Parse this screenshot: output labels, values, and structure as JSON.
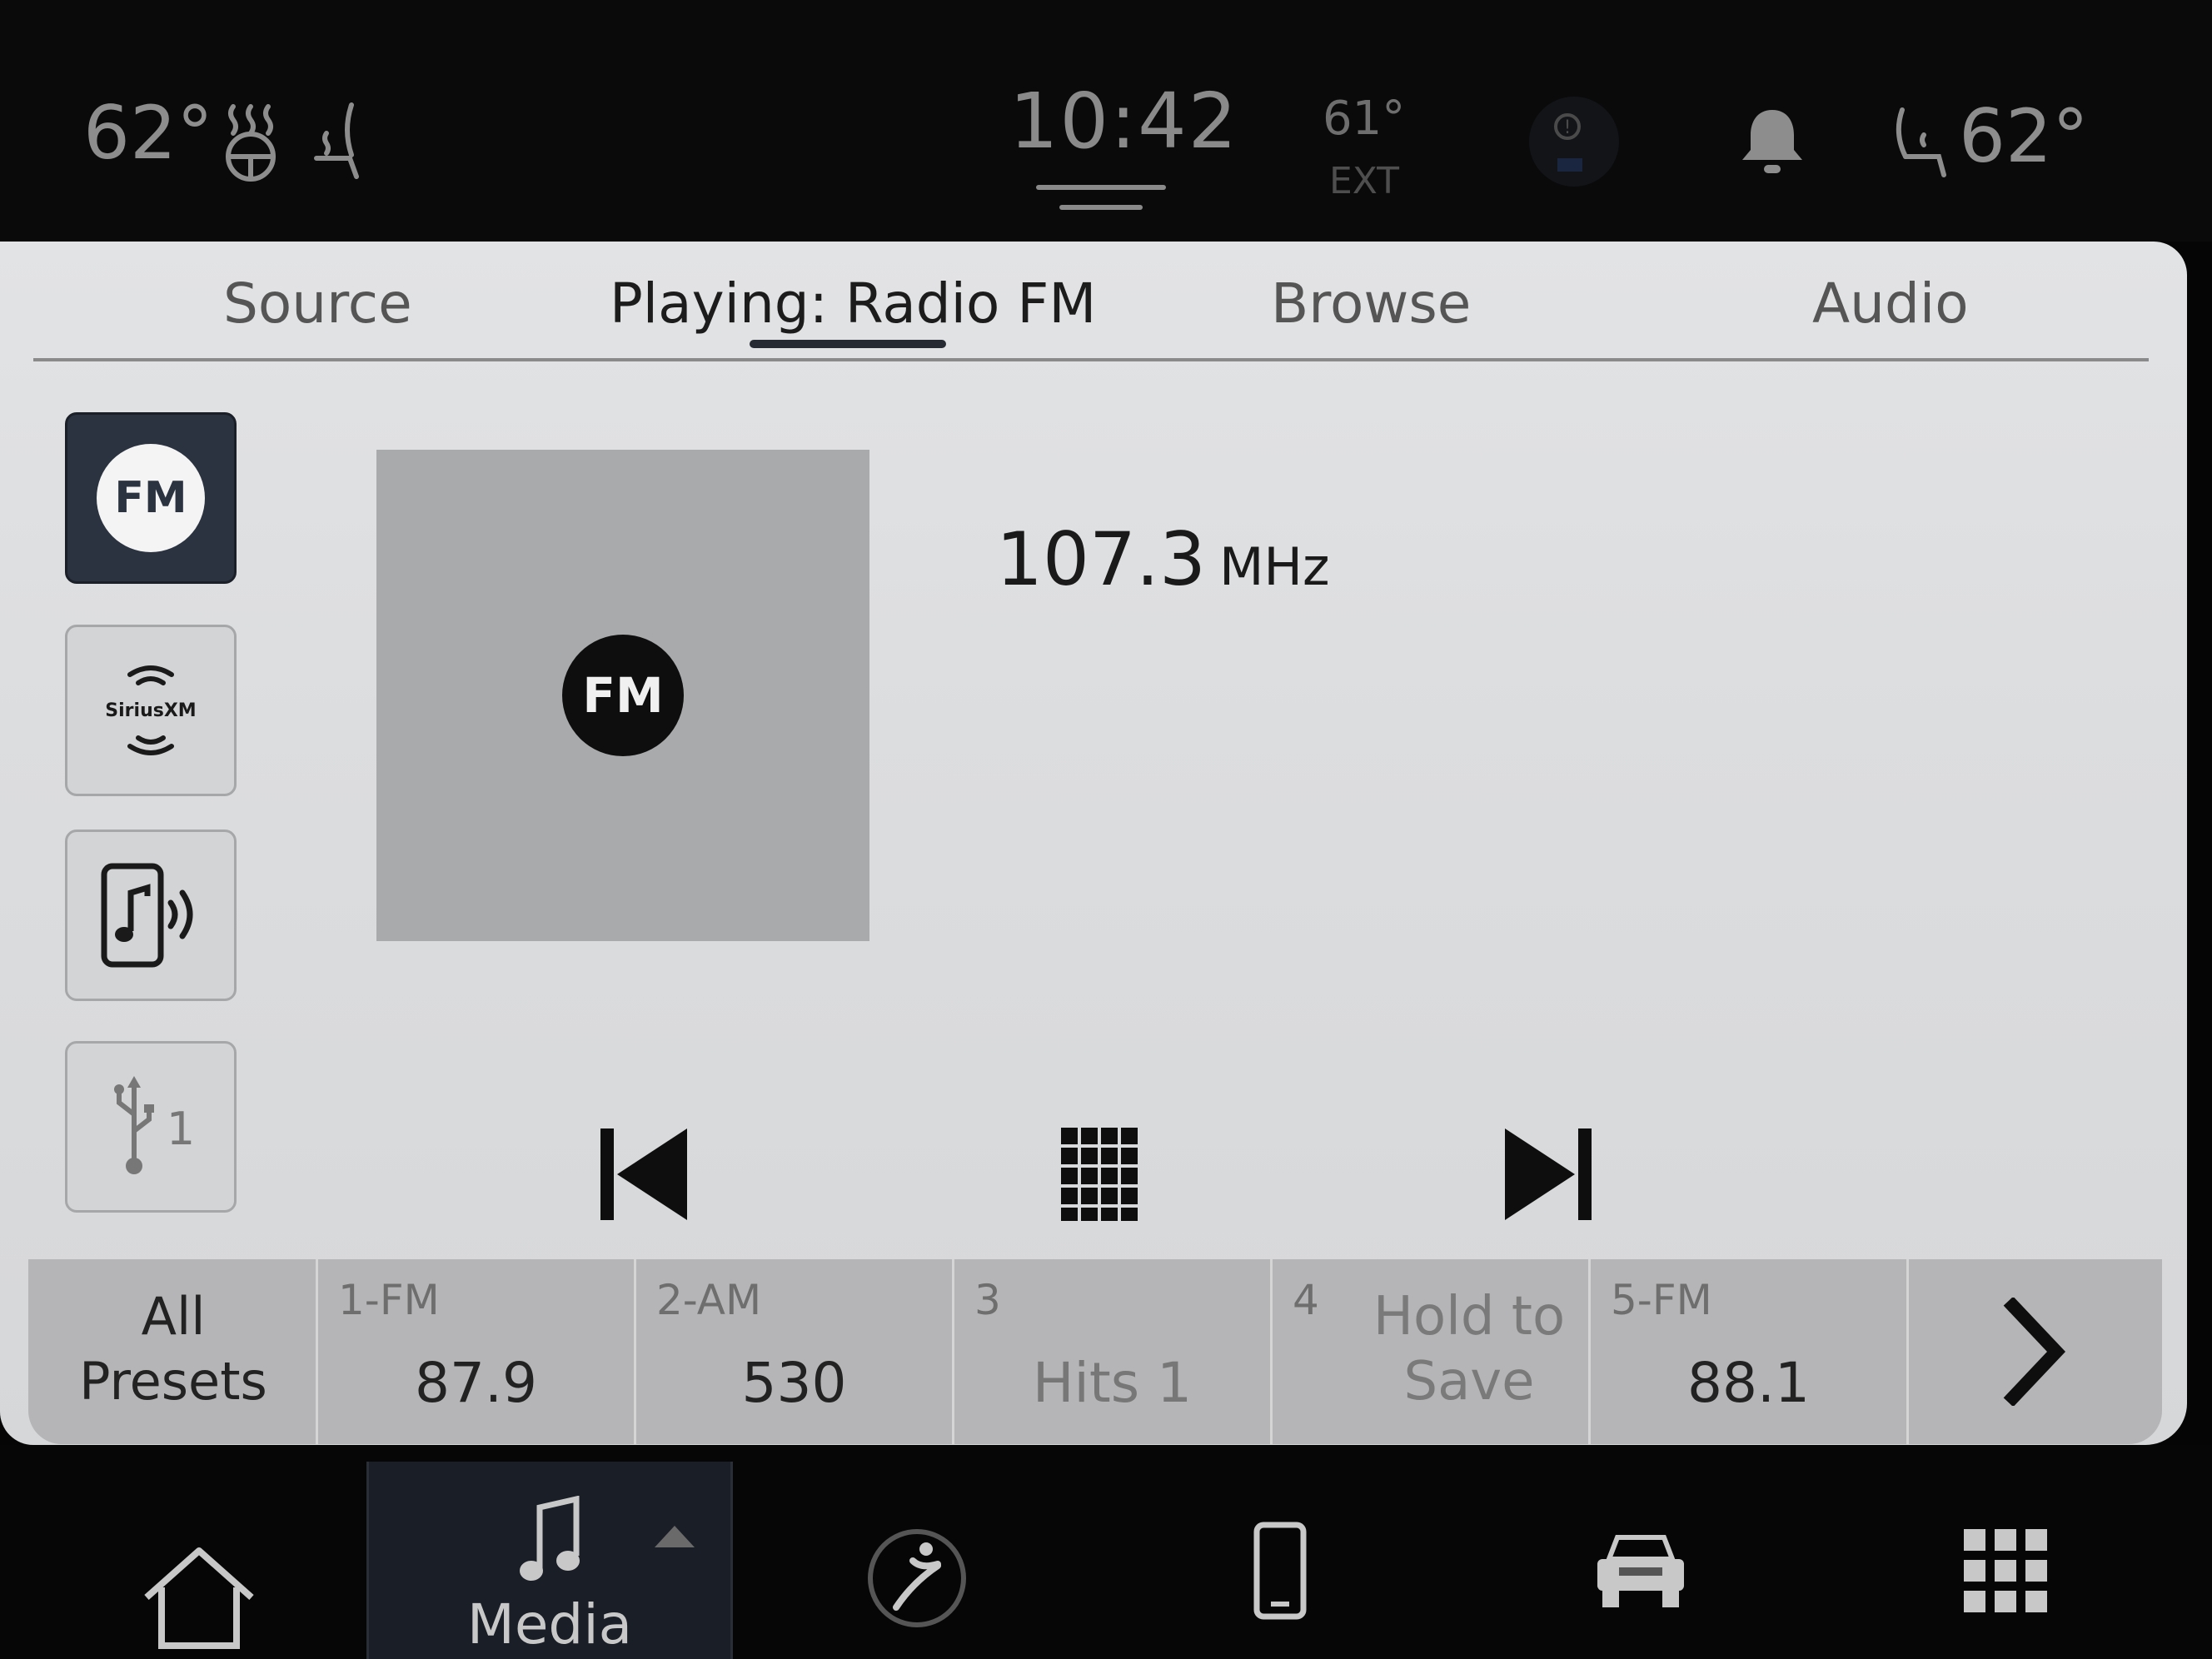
{
  "status_bar": {
    "driver_temp": "62°",
    "passenger_temp": "62°",
    "clock": "10:42",
    "exterior_temp": "61°",
    "exterior_label": "EXT"
  },
  "tabs": [
    {
      "label": "Source"
    },
    {
      "label": "Playing: Radio FM"
    },
    {
      "label": "Browse"
    },
    {
      "label": "Audio"
    }
  ],
  "active_tab": "Playing: Radio FM",
  "sources": {
    "fm_label": "FM",
    "siriusxm_label": "SiriusXM",
    "usb_label": "1"
  },
  "now_playing": {
    "art_label": "FM",
    "frequency": "107.3",
    "unit": "MHz"
  },
  "presets": {
    "all_label": "All\nPresets",
    "items": [
      {
        "number": "1-FM",
        "value": "87.9"
      },
      {
        "number": "2-AM",
        "value": "530"
      },
      {
        "number": "3",
        "value": "Hits 1"
      },
      {
        "number": "4",
        "value": "Hold to\nSave"
      },
      {
        "number": "5-FM",
        "value": "88.1"
      }
    ]
  },
  "bottom_nav": {
    "media_label": "Media"
  },
  "colors": {
    "active_source_bg": "#2b3340",
    "screen_bg": "#dcdddf",
    "preset_bar_bg": "#b5b5b7",
    "status_bar_bg": "#0a0a0a"
  },
  "icons": [
    "heated-steering-icon",
    "heated-seat-icon",
    "notification-bell-icon",
    "passenger-seat-icon",
    "skip-previous-icon",
    "keypad-icon",
    "skip-next-icon",
    "chevron-right-icon",
    "home-icon",
    "music-note-icon",
    "climate-icon",
    "phone-icon",
    "vehicle-icon",
    "apps-grid-icon",
    "usb-icon",
    "bluetooth-audio-icon",
    "siriusxm-icon"
  ]
}
